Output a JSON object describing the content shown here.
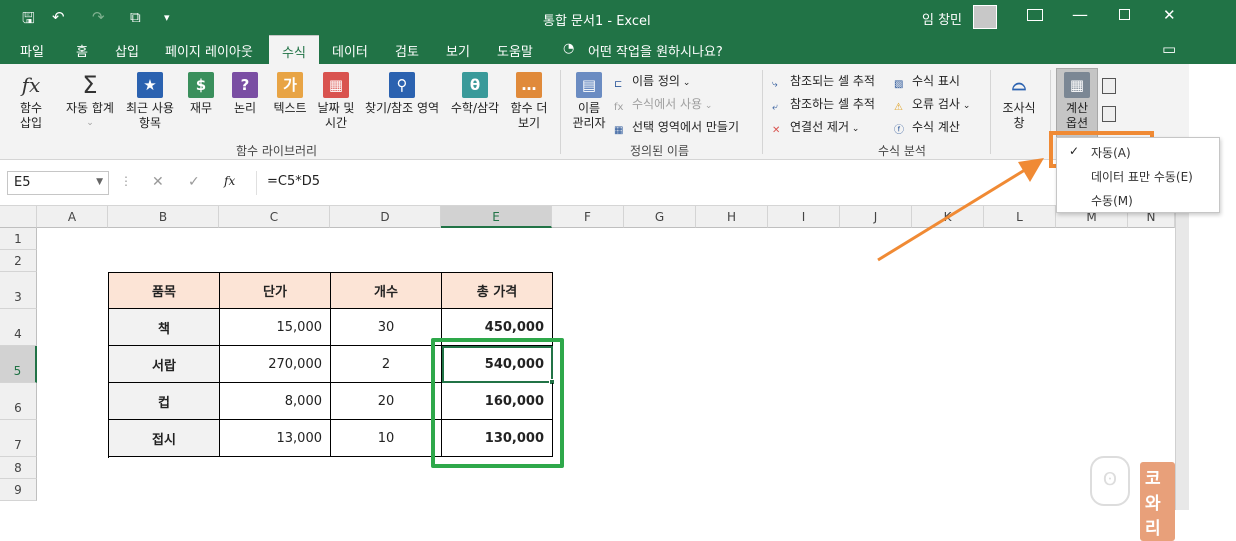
{
  "title": {
    "text": "통합 문서1 - Excel",
    "user": "임 창민"
  },
  "tabs": [
    "파일",
    "홈",
    "삽입",
    "페이지 레이아웃",
    "수식",
    "데이터",
    "검토",
    "보기",
    "도움말"
  ],
  "tell_me": "어떤 작업을 원하시나요?",
  "ribbon": {
    "insert_function": [
      "함수",
      "삽입"
    ],
    "autosum": [
      "자동 합계"
    ],
    "recent": [
      "최근 사용",
      "항목"
    ],
    "financial": [
      "재무"
    ],
    "logical": [
      "논리"
    ],
    "text": [
      "텍스트"
    ],
    "datetime": [
      "날짜 및",
      "시간"
    ],
    "lookup": [
      "찾기/참조 영역"
    ],
    "math": [
      "수학/삼각"
    ],
    "more": [
      "함수 더",
      "보기"
    ],
    "group_library": "함수 라이브러리",
    "name_manager": [
      "이름",
      "관리자"
    ],
    "define_name": "이름 정의",
    "use_in_formula": "수식에서 사용",
    "create_from_selection": "선택 영역에서 만들기",
    "group_names": "정의된 이름",
    "trace_precedents": "참조되는 셀 추적",
    "trace_dependents": "참조하는 셀 추적",
    "remove_arrows": "연결선 제거",
    "show_formulas": "수식 표시",
    "error_checking": "오류 검사",
    "evaluate_formula": "수식 계산",
    "group_audit": "수식 분석",
    "watch": [
      "조사식",
      "창"
    ],
    "calc_options": [
      "계산",
      "옵션"
    ]
  },
  "dropdown": {
    "items": [
      "자동(A)",
      "데이터 표만 수동(E)",
      "수동(M)"
    ],
    "checked": 0
  },
  "formula_bar": {
    "name_box": "E5",
    "cancel": "✕",
    "enter": "✓",
    "fx": "fx",
    "formula": "=C5*D5"
  },
  "columns": [
    "A",
    "B",
    "C",
    "D",
    "E",
    "F",
    "G",
    "H",
    "I",
    "J",
    "K",
    "L",
    "M",
    "N"
  ],
  "rows": [
    "1",
    "2",
    "3",
    "4",
    "5",
    "6",
    "7",
    "8",
    "9"
  ],
  "table": {
    "headers": [
      "품목",
      "단가",
      "개수",
      "총 가격"
    ],
    "rows": [
      [
        "책",
        "15,000",
        "30",
        "450,000"
      ],
      [
        "서랍",
        "270,000",
        "2",
        "540,000"
      ],
      [
        "컵",
        "8,000",
        "20",
        "160,000"
      ],
      [
        "접시",
        "13,000",
        "10",
        "130,000"
      ]
    ]
  },
  "watermark": "코와리",
  "colors": {
    "excel_green": "#217346",
    "highlight_orange": "#f08a34",
    "highlight_green": "#2ea84a",
    "header_fill": "#fce4d6"
  }
}
